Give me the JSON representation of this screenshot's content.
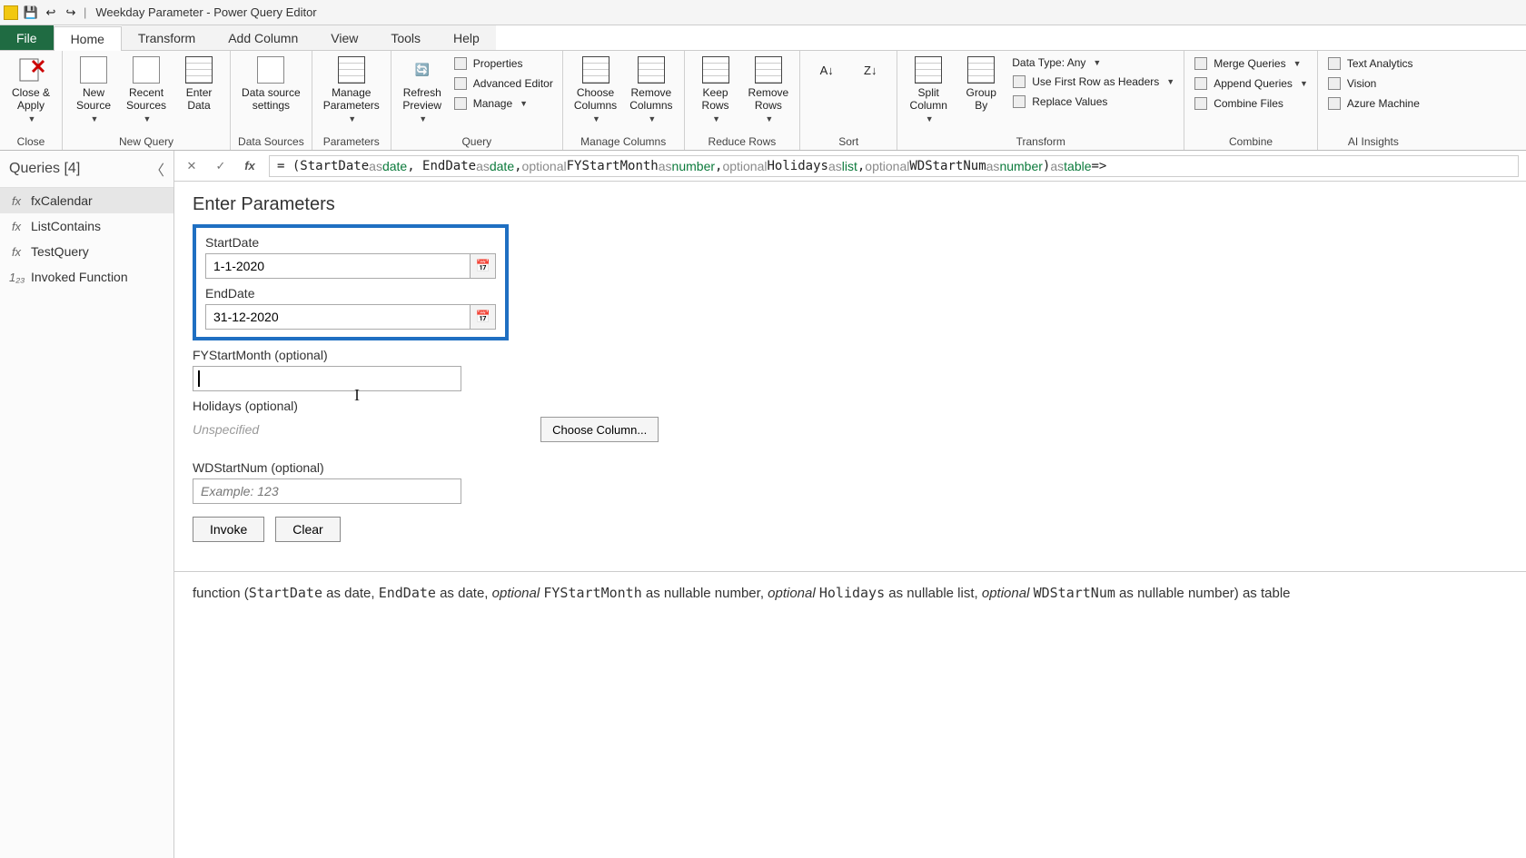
{
  "title": "Weekday Parameter - Power Query Editor",
  "menus": {
    "file": "File",
    "home": "Home",
    "transform": "Transform",
    "addcol": "Add Column",
    "view": "View",
    "tools": "Tools",
    "help": "Help"
  },
  "ribbon": {
    "close": {
      "closeApply": "Close &\nApply",
      "group": "Close"
    },
    "newQuery": {
      "newSource": "New\nSource",
      "recentSources": "Recent\nSources",
      "enterData": "Enter\nData",
      "group": "New Query"
    },
    "dataSources": {
      "dsSettings": "Data source\nsettings",
      "group": "Data Sources"
    },
    "parameters": {
      "manageParams": "Manage\nParameters",
      "group": "Parameters"
    },
    "query": {
      "refresh": "Refresh\nPreview",
      "properties": "Properties",
      "advEditor": "Advanced Editor",
      "manage": "Manage",
      "group": "Query"
    },
    "manageCols": {
      "choose": "Choose\nColumns",
      "remove": "Remove\nColumns",
      "group": "Manage Columns"
    },
    "reduceRows": {
      "keep": "Keep\nRows",
      "remove": "Remove\nRows",
      "group": "Reduce Rows"
    },
    "sort": {
      "group": "Sort"
    },
    "transform": {
      "split": "Split\nColumn",
      "groupBy": "Group\nBy",
      "dataType": "Data Type: Any",
      "firstRow": "Use First Row as Headers",
      "replace": "Replace Values",
      "group": "Transform"
    },
    "combine": {
      "merge": "Merge Queries",
      "append": "Append Queries",
      "combineFiles": "Combine Files",
      "group": "Combine"
    },
    "ai": {
      "text": "Text Analytics",
      "vision": "Vision",
      "azure": "Azure Machine",
      "group": "AI Insights"
    }
  },
  "sidebar": {
    "header": "Queries [4]",
    "items": [
      {
        "icon": "fx",
        "label": "fxCalendar",
        "sel": true
      },
      {
        "icon": "fx",
        "label": "ListContains",
        "sel": false
      },
      {
        "icon": "fx",
        "label": "TestQuery",
        "sel": false
      },
      {
        "icon": "1₂₃",
        "label": "Invoked Function",
        "sel": false
      }
    ]
  },
  "formula": "= (StartDate as date, EndDate as date, optional FYStartMonth as number, optional Holidays as list, optional WDStartNum as number) as table =>",
  "params": {
    "title": "Enter Parameters",
    "startDate": {
      "label": "StartDate",
      "value": "1-1-2020"
    },
    "endDate": {
      "label": "EndDate",
      "value": "31-12-2020"
    },
    "fystart": {
      "label": "FYStartMonth (optional)",
      "value": ""
    },
    "holidays": {
      "label": "Holidays (optional)",
      "value": "Unspecified",
      "choose": "Choose Column..."
    },
    "wdstart": {
      "label": "WDStartNum (optional)",
      "placeholder": "Example: 123"
    },
    "invoke": "Invoke",
    "clear": "Clear"
  },
  "signature": {
    "pre": "function (",
    "sd": "StartDate",
    "asdate": " as date, ",
    "ed": "EndDate",
    "asdate2": " as date, ",
    "opt": "optional ",
    "fy": "FYStartMonth",
    "asnn": " as nullable number, ",
    "hol": "Holidays",
    "asnl": " as nullable list, ",
    "wd": "WDStartNum",
    "asnn2": " as nullable number) as table"
  }
}
